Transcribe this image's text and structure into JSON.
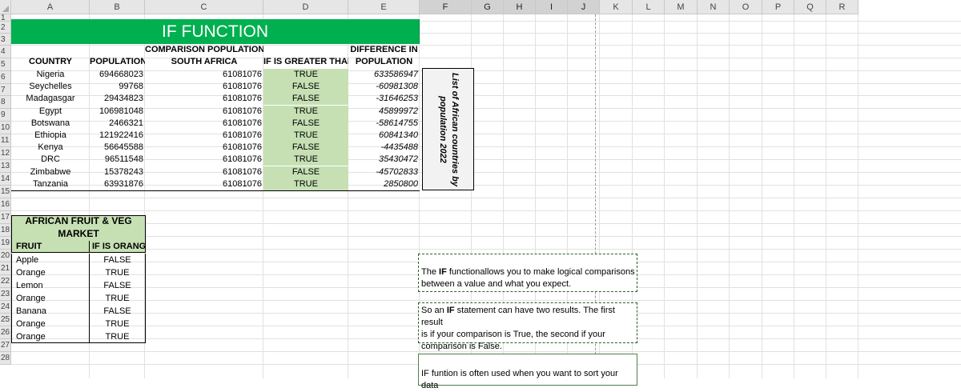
{
  "columns": [
    "A",
    "B",
    "C",
    "D",
    "E",
    "F",
    "G",
    "H",
    "I",
    "J",
    "K",
    "L",
    "M",
    "N",
    "O",
    "P",
    "Q",
    "R"
  ],
  "rows": [
    "1",
    "2",
    "3",
    "4",
    "5",
    "6",
    "7",
    "8",
    "9",
    "10",
    "11",
    "12",
    "13",
    "14",
    "15",
    "16",
    "17",
    "18",
    "19",
    "20",
    "21",
    "22",
    "23",
    "24",
    "25",
    "26",
    "27",
    "28"
  ],
  "title": "IF FUNCTION",
  "main_table": {
    "headers": {
      "country": "COUNTRY",
      "population": "POPULATION",
      "comparison_line1": "COMPARISON POPULATION",
      "comparison_line2": "SOUTH AFRICA",
      "greater": "IF IS GREATER THAN",
      "difference_line1": "DIFFERENCE IN",
      "difference_line2": "POPULATION"
    },
    "rows": [
      {
        "country": "Nigeria",
        "population": "694668023",
        "comparison": "61081076",
        "greater": "TRUE",
        "difference": "633586947"
      },
      {
        "country": "Seychelles",
        "population": "99768",
        "comparison": "61081076",
        "greater": "FALSE",
        "difference": "-60981308"
      },
      {
        "country": "Madagasgar",
        "population": "29434823",
        "comparison": "61081076",
        "greater": "FALSE",
        "difference": "-31646253"
      },
      {
        "country": "Egypt",
        "population": "106981048",
        "comparison": "61081076",
        "greater": "TRUE",
        "difference": "45899972"
      },
      {
        "country": "Botswana",
        "population": "2466321",
        "comparison": "61081076",
        "greater": "FALSE",
        "difference": "-58614755"
      },
      {
        "country": "Ethiopia",
        "population": "121922416",
        "comparison": "61081076",
        "greater": "TRUE",
        "difference": "60841340"
      },
      {
        "country": "Kenya",
        "population": "56645588",
        "comparison": "61081076",
        "greater": "FALSE",
        "difference": "-4435488"
      },
      {
        "country": "DRC",
        "population": "96511548",
        "comparison": "61081076",
        "greater": "TRUE",
        "difference": "35430472"
      },
      {
        "country": "Zimbabwe",
        "population": "15378243",
        "comparison": "61081076",
        "greater": "FALSE",
        "difference": "-45702833"
      },
      {
        "country": "Tanzania",
        "population": "63931876",
        "comparison": "61081076",
        "greater": "TRUE",
        "difference": "2850800"
      }
    ]
  },
  "side_label_line1": "List of African countries by",
  "side_label_line2": "population 2022",
  "fruit_table": {
    "title_line1": "AFRICAN FRUIT & VEG",
    "title_line2": "MARKET",
    "headers": {
      "fruit": "FRUIT",
      "is_orange": "IF IS ORANGE"
    },
    "rows": [
      {
        "fruit": "Apple",
        "is_orange": "FALSE"
      },
      {
        "fruit": "Orange",
        "is_orange": "TRUE"
      },
      {
        "fruit": "Lemon",
        "is_orange": "FALSE"
      },
      {
        "fruit": "Orange",
        "is_orange": "TRUE"
      },
      {
        "fruit": "Banana",
        "is_orange": "FALSE"
      },
      {
        "fruit": "Orange",
        "is_orange": "TRUE"
      },
      {
        "fruit": "Orange",
        "is_orange": "TRUE"
      }
    ]
  },
  "notes": {
    "note1_pre": "The ",
    "note1_bold": "IF",
    "note1_post": " functionallows you to make logical comparisons",
    "note1_line2": "between a value and what you expect.",
    "note2_pre": "So an ",
    "note2_bold": "IF",
    "note2_post": " statement can have two results. The first result",
    "note2_line2": "is if your comparison is True, the second if your",
    "note2_line3": "comparison is False.",
    "note3": "IF funtion is often used when you want to sort your data"
  },
  "colors": {
    "title_bg": "#00b050",
    "green_cell": "#c6e0b4",
    "header_bg": "#e6e6e6"
  }
}
